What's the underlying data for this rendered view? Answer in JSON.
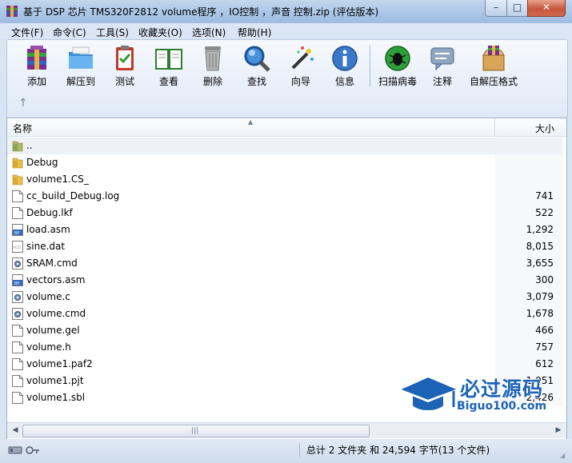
{
  "window": {
    "title": "基于 DSP 芯片 TMS320F2812 volume程序 ，IO控制 ，声音 控制.zip (评估版本)"
  },
  "menu": [
    "文件(F)",
    "命令(C)",
    "工具(S)",
    "收藏夹(O)",
    "选项(N)",
    "帮助(H)"
  ],
  "toolbar": {
    "tools": [
      {
        "label": "添加",
        "icon": "add-archive-icon"
      },
      {
        "label": "解压到",
        "icon": "extract-folder-icon"
      },
      {
        "label": "测试",
        "icon": "test-clipboard-icon"
      },
      {
        "label": "查看",
        "icon": "view-book-icon"
      },
      {
        "label": "删除",
        "icon": "trash-icon"
      },
      {
        "label": "查找",
        "icon": "search-magnifier-icon"
      },
      {
        "label": "向导",
        "icon": "wizard-wand-icon"
      },
      {
        "label": "信息",
        "icon": "info-icon"
      },
      {
        "label": "扫描病毒",
        "icon": "virus-scan-icon"
      },
      {
        "label": "注释",
        "icon": "comment-icon"
      },
      {
        "label": "自解压格式",
        "icon": "sfx-box-icon"
      }
    ]
  },
  "columns": {
    "name": "名称",
    "size": "大小"
  },
  "files": [
    {
      "name": "..",
      "size": "",
      "type": "parent"
    },
    {
      "name": "Debug",
      "size": "",
      "type": "folder"
    },
    {
      "name": "volume1.CS_",
      "size": "",
      "type": "folder"
    },
    {
      "name": "cc_build_Debug.log",
      "size": "741",
      "type": "file"
    },
    {
      "name": "Debug.lkf",
      "size": "522",
      "type": "file"
    },
    {
      "name": "load.asm",
      "size": "1,292",
      "type": "asm"
    },
    {
      "name": "sine.dat",
      "size": "8,015",
      "type": "vcd"
    },
    {
      "name": "SRAM.cmd",
      "size": "3,655",
      "type": "cmd"
    },
    {
      "name": "vectors.asm",
      "size": "300",
      "type": "asm"
    },
    {
      "name": "volume.c",
      "size": "3,079",
      "type": "cmd"
    },
    {
      "name": "volume.cmd",
      "size": "1,678",
      "type": "cmd"
    },
    {
      "name": "volume.gel",
      "size": "466",
      "type": "file"
    },
    {
      "name": "volume.h",
      "size": "757",
      "type": "file"
    },
    {
      "name": "volume1.paf2",
      "size": "612",
      "type": "file"
    },
    {
      "name": "volume1.pjt",
      "size": "1,051",
      "type": "file"
    },
    {
      "name": "volume1.sbl",
      "size": "2,426",
      "type": "file"
    }
  ],
  "watermark": {
    "title": "必过源码",
    "subtitle": "Biguo100.com"
  },
  "status": {
    "summary": "总计 2 文件夹 和 24,594 字节(13 个文件)"
  }
}
